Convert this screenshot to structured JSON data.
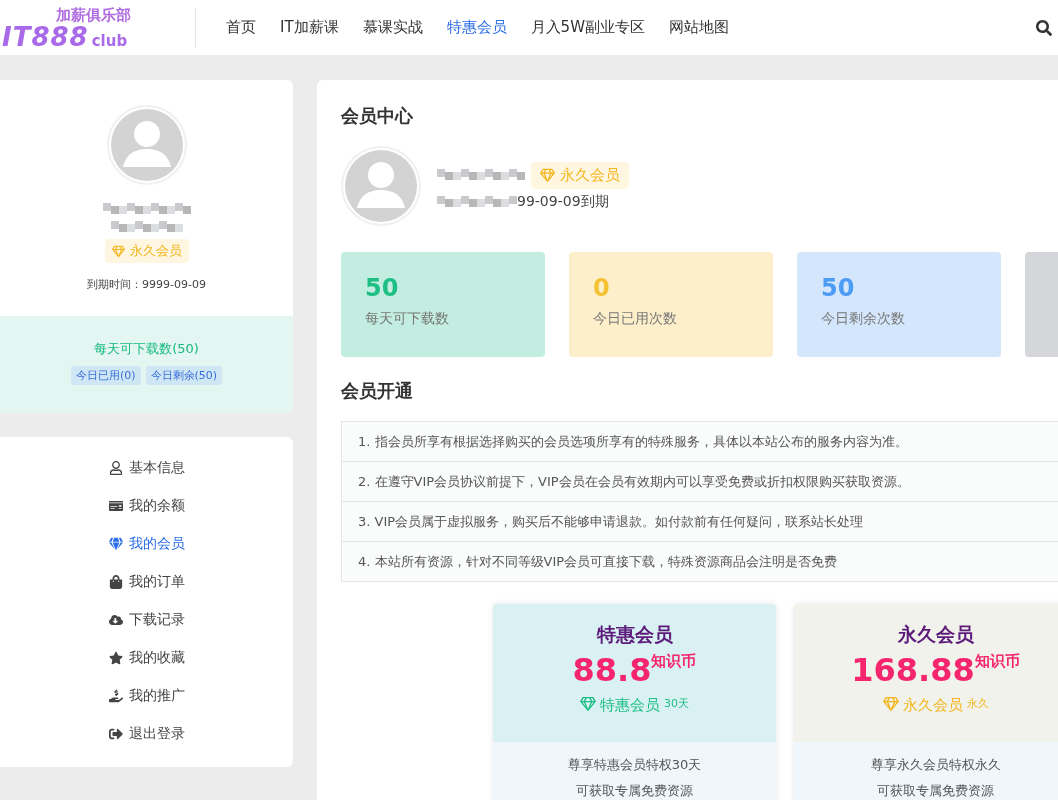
{
  "header": {
    "logo": {
      "tagline": "加薪俱乐部",
      "mark": "IT888",
      "suffix": "club"
    },
    "nav": [
      {
        "label": "首页",
        "selected": false
      },
      {
        "label": "IT加薪课",
        "selected": false
      },
      {
        "label": "慕课实战",
        "selected": false
      },
      {
        "label": "特惠会员",
        "selected": true
      },
      {
        "label": "月入5W副业专区",
        "selected": false
      },
      {
        "label": "网站地图",
        "selected": false
      }
    ]
  },
  "profile": {
    "badge": "永久会员",
    "expiry": "到期时间：9999-09-09"
  },
  "quota": {
    "title": "每天可下载数(50)",
    "chips": [
      "今日已用(0)",
      "今日剩余(50)"
    ]
  },
  "menu": [
    {
      "label": "基本信息",
      "selected": false
    },
    {
      "label": "我的余额",
      "selected": false
    },
    {
      "label": "我的会员",
      "selected": true
    },
    {
      "label": "我的订单",
      "selected": false
    },
    {
      "label": "下载记录",
      "selected": false
    },
    {
      "label": "我的收藏",
      "selected": false
    },
    {
      "label": "我的推广",
      "selected": false
    },
    {
      "label": "退出登录",
      "selected": false
    }
  ],
  "member_center": {
    "title": "会员中心",
    "badge": "永久会员",
    "expiry": "99-09-09到期",
    "stats": [
      {
        "value": "50",
        "label": "每天可下载数",
        "color": "#c3ede0"
      },
      {
        "value": "0",
        "label": "今日已用次数",
        "color": "#fdefc9"
      },
      {
        "value": "50",
        "label": "今日剩余次数",
        "color": "#d4e6fc"
      },
      {
        "color": "#d5d6da"
      }
    ]
  },
  "vip_section": {
    "title": "会员开通",
    "notes": [
      "1. 指会员所享有根据选择购买的会员选项所享有的特殊服务，具体以本站公布的服务内容为准。",
      "2. 在遵守VIP会员协议前提下，VIP会员在会员有效期内可以享受免费或折扣权限购买获取资源。",
      "3. VIP会员属于虚拟服务，购买后不能够申请退款。如付款前有任何疑问，联系站长处理",
      "4. 本站所有资源，针对不同等级VIP会员可直接下载，特殊资源商品会注明是否免费"
    ],
    "plans": [
      {
        "kind": "limited",
        "name": "特惠会员",
        "price": "88.8",
        "unit": "知识币",
        "badge": "特惠会员",
        "term": "30天",
        "perks": [
          "尊享特惠会员特权30天",
          "可获取专属免费资源"
        ]
      },
      {
        "kind": "lifetime",
        "name": "永久会员",
        "price": "168.88",
        "unit": "知识币",
        "badge": "永久会员",
        "term": "永久",
        "perks": [
          "尊享永久会员特权永久",
          "可获取专属免费资源"
        ]
      }
    ]
  }
}
